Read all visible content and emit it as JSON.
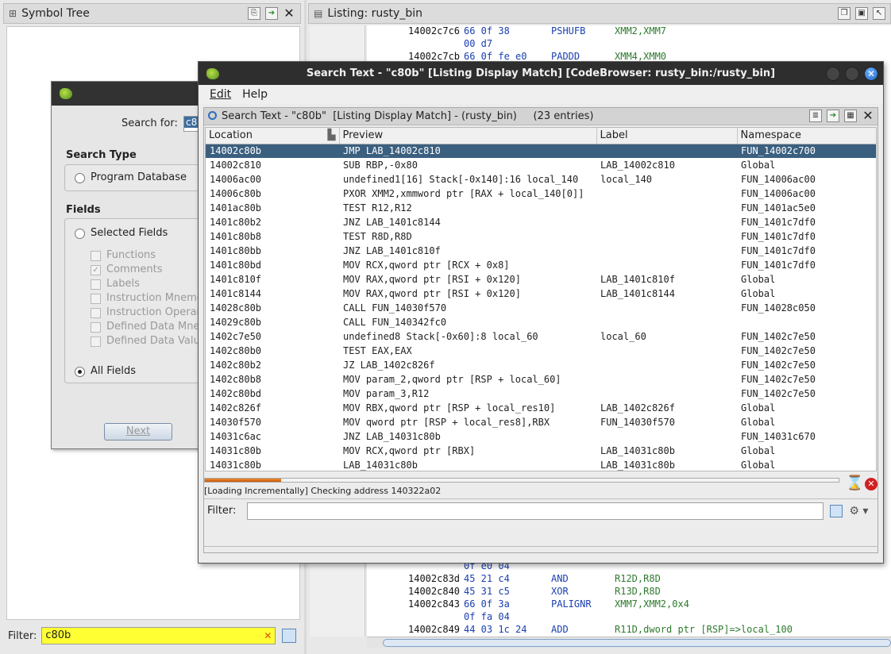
{
  "symbol_tree": {
    "title": "Symbol Tree",
    "filter_label": "Filter:",
    "filter_value": "c80b"
  },
  "listing": {
    "title": "Listing:  rusty_bin",
    "rows": [
      {
        "addr": "14002c7c6",
        "bytes": "66 0f 38",
        "mnemonic": "PSHUFB",
        "operands": "XMM2,XMM7"
      },
      {
        "addr": "",
        "bytes": "00 d7",
        "mnemonic": "",
        "operands": ""
      },
      {
        "addr": "14002c7cb",
        "bytes": "66 0f fe e0",
        "mnemonic": "PADDD",
        "operands": "XMM4,XMM0"
      }
    ],
    "rows_bottom": [
      {
        "addr": "",
        "bytes": "0f e0 04",
        "mnemonic": "",
        "operands": ""
      },
      {
        "addr": "14002c83d",
        "bytes": "45 21 c4",
        "mnemonic": "AND",
        "operands": "R12D,R8D"
      },
      {
        "addr": "14002c840",
        "bytes": "45 31 c5",
        "mnemonic": "XOR",
        "operands": "R13D,R8D"
      },
      {
        "addr": "14002c843",
        "bytes": "66 0f 3a",
        "mnemonic": "PALIGNR",
        "operands": "XMM7,XMM2,0x4"
      },
      {
        "addr": "",
        "bytes": "0f fa 04",
        "mnemonic": "",
        "operands": ""
      },
      {
        "addr": "14002c849",
        "bytes": "44 03 1c 24",
        "mnemonic": "ADD",
        "operands": "R11D,dword ptr [RSP]=>local_100"
      }
    ]
  },
  "search_dialog": {
    "search_for_label": "Search for:",
    "search_for_value": "c8",
    "search_type_label": "Search Type",
    "program_database_label": "Program Database",
    "fields_label": "Fields",
    "selected_fields_label": "Selected Fields",
    "checkboxes": [
      {
        "label": "Functions",
        "checked": false
      },
      {
        "label": "Comments",
        "checked": true
      },
      {
        "label": "Labels",
        "checked": false
      },
      {
        "label": "Instruction Mnemo",
        "checked": false
      },
      {
        "label": "Instruction Operan",
        "checked": false
      },
      {
        "label": "Defined Data Mne",
        "checked": false
      },
      {
        "label": "Defined Data Valu",
        "checked": false
      }
    ],
    "all_fields_label": "All Fields",
    "next_label": "Next"
  },
  "results": {
    "window_title": "Search Text - \"c80b\"  [Listing Display Match] [CodeBrowser: rusty_bin:/rusty_bin]",
    "menu": [
      "Edit",
      "Help"
    ],
    "subtitle": "Search Text - \"c80b\"  [Listing Display Match] - (rusty_bin)     (23 entries)",
    "columns": [
      "Location",
      "Preview",
      "Label",
      "Namespace"
    ],
    "rows": [
      {
        "location": "14002c80b",
        "preview": "JMP LAB_14002c810",
        "label": "",
        "namespace": "FUN_14002c700"
      },
      {
        "location": "14002c810",
        "preview": "SUB RBP,-0x80",
        "label": "LAB_14002c810",
        "namespace": "Global"
      },
      {
        "location": "14006ac00",
        "preview": "undefined1[16] Stack[-0x140]:16 local_140",
        "label": "local_140",
        "namespace": "FUN_14006ac00"
      },
      {
        "location": "14006c80b",
        "preview": "PXOR XMM2,xmmword ptr [RAX + local_140[0]]",
        "label": "",
        "namespace": "FUN_14006ac00"
      },
      {
        "location": "1401ac80b",
        "preview": "TEST R12,R12",
        "label": "",
        "namespace": "FUN_1401ac5e0"
      },
      {
        "location": "1401c80b2",
        "preview": "JNZ LAB_1401c8144",
        "label": "",
        "namespace": "FUN_1401c7df0"
      },
      {
        "location": "1401c80b8",
        "preview": "TEST R8D,R8D",
        "label": "",
        "namespace": "FUN_1401c7df0"
      },
      {
        "location": "1401c80bb",
        "preview": "JNZ LAB_1401c810f",
        "label": "",
        "namespace": "FUN_1401c7df0"
      },
      {
        "location": "1401c80bd",
        "preview": "MOV RCX,qword ptr [RCX + 0x8]",
        "label": "",
        "namespace": "FUN_1401c7df0"
      },
      {
        "location": "1401c810f",
        "preview": "MOV RAX,qword ptr [RSI + 0x120]",
        "label": "LAB_1401c810f",
        "namespace": "Global"
      },
      {
        "location": "1401c8144",
        "preview": "MOV RAX,qword ptr [RSI + 0x120]",
        "label": "LAB_1401c8144",
        "namespace": "Global"
      },
      {
        "location": "14028c80b",
        "preview": "CALL FUN_14030f570",
        "label": "",
        "namespace": "FUN_14028c050"
      },
      {
        "location": "14029c80b",
        "preview": "CALL FUN_140342fc0",
        "label": "",
        "namespace": ""
      },
      {
        "location": "1402c7e50",
        "preview": "undefined8 Stack[-0x60]:8 local_60",
        "label": "local_60",
        "namespace": "FUN_1402c7e50"
      },
      {
        "location": "1402c80b0",
        "preview": "TEST EAX,EAX",
        "label": "",
        "namespace": "FUN_1402c7e50"
      },
      {
        "location": "1402c80b2",
        "preview": "JZ LAB_1402c826f",
        "label": "",
        "namespace": "FUN_1402c7e50"
      },
      {
        "location": "1402c80b8",
        "preview": "MOV param_2,qword ptr [RSP + local_60]",
        "label": "",
        "namespace": "FUN_1402c7e50"
      },
      {
        "location": "1402c80bd",
        "preview": "MOV param_3,R12",
        "label": "",
        "namespace": "FUN_1402c7e50"
      },
      {
        "location": "1402c826f",
        "preview": "MOV RBX,qword ptr [RSP + local_res10]",
        "label": "LAB_1402c826f",
        "namespace": "Global"
      },
      {
        "location": "14030f570",
        "preview": "MOV qword ptr [RSP + local_res8],RBX",
        "label": "FUN_14030f570",
        "namespace": "Global"
      },
      {
        "location": "14031c6ac",
        "preview": "JNZ LAB_14031c80b",
        "label": "",
        "namespace": "FUN_14031c670"
      },
      {
        "location": "14031c80b",
        "preview": "MOV RCX,qword ptr [RBX]",
        "label": "LAB_14031c80b",
        "namespace": "Global"
      },
      {
        "location": "14031c80b",
        "preview": "LAB_14031c80b",
        "label": "LAB_14031c80b",
        "namespace": "Global"
      }
    ],
    "progress": 0.12,
    "status": "[Loading Incrementally] Checking address 140322a02",
    "filter_label": "Filter:"
  }
}
